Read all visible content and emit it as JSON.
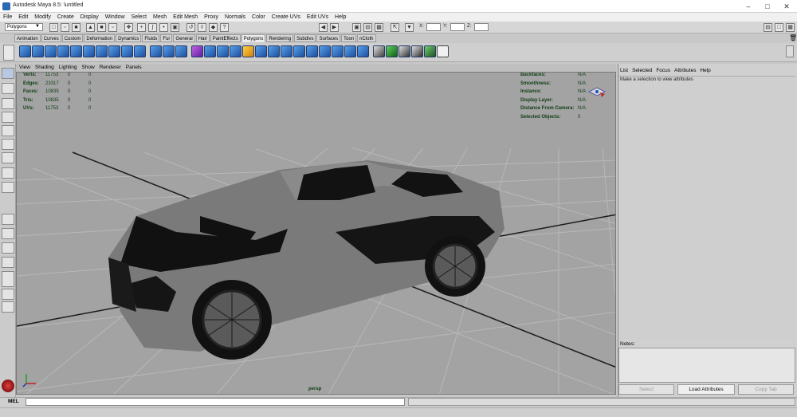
{
  "window": {
    "title": "Autodesk Maya 8.5: \\untitled"
  },
  "menubar": [
    "File",
    "Edit",
    "Modify",
    "Create",
    "Display",
    "Window",
    "Select",
    "Mesh",
    "Edit Mesh",
    "Proxy",
    "Normals",
    "Color",
    "Create UVs",
    "Edit UVs",
    "Help"
  ],
  "statusline": {
    "mode": "Polygons",
    "x_label": "X:",
    "y_label": "Y:",
    "z_label": "Z:"
  },
  "shelf_tabs": [
    "Animation",
    "Curves",
    "Custom",
    "Deformation",
    "Dynamics",
    "Fluids",
    "Fur",
    "General",
    "Hair",
    "PaintEffects",
    "Polygons",
    "Rendering",
    "Subdivs",
    "Surfaces",
    "Toon",
    "nCloth"
  ],
  "shelf_active": "Polygons",
  "viewport_menu": [
    "View",
    "Shading",
    "Lighting",
    "Show",
    "Renderer",
    "Panels"
  ],
  "hud_left": [
    {
      "label": "Verts:",
      "v1": "11753",
      "v2": "0",
      "v3": "0"
    },
    {
      "label": "Edges:",
      "v1": "23317",
      "v2": "0",
      "v3": "0"
    },
    {
      "label": "Faces:",
      "v1": "10835",
      "v2": "0",
      "v3": "0"
    },
    {
      "label": "Tris:",
      "v1": "10835",
      "v2": "0",
      "v3": "0"
    },
    {
      "label": "UVs:",
      "v1": "11753",
      "v2": "0",
      "v3": "0"
    }
  ],
  "hud_right": [
    {
      "label": "Backfaces:",
      "value": "N/A"
    },
    {
      "label": "Smoothness:",
      "value": "N/A"
    },
    {
      "label": "Instance:",
      "value": "N/A"
    },
    {
      "label": "Display Layer:",
      "value": "N/A"
    },
    {
      "label": "Distance From Camera:",
      "value": "N/A"
    },
    {
      "label": "Selected Objects:",
      "value": "0"
    }
  ],
  "camera": "persp",
  "attribute_editor": {
    "menu": [
      "List",
      "Selected",
      "Focus",
      "Attributes",
      "Help"
    ],
    "hint": "Make a selection to view attributes",
    "notes_label": "Notes:",
    "buttons": [
      "Select",
      "Load Attributes",
      "Copy Tab"
    ]
  },
  "command_line": {
    "label": "MEL"
  },
  "colors": {
    "viewport_bg": "#a3a3a3",
    "grid": "#b4b4b4",
    "hud_text": "#0e3d12",
    "car_body": "#7a7a7a",
    "car_shadow": "#101010"
  }
}
